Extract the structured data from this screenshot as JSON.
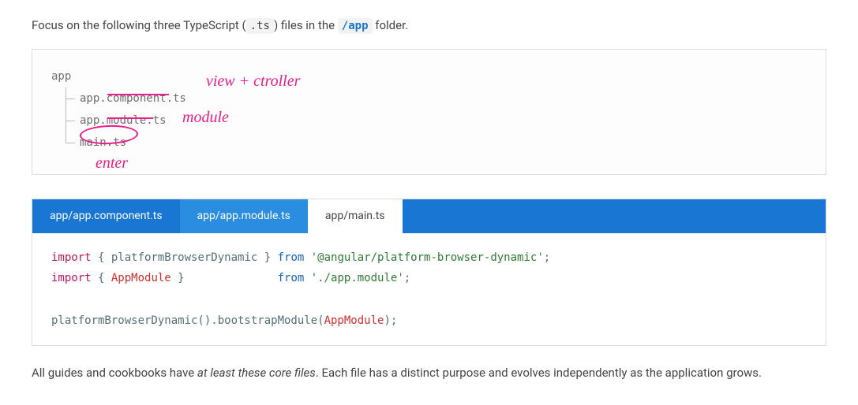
{
  "intro": {
    "prefix": "Focus on the following three TypeScript (",
    "ext": ".ts",
    "mid": ") files in the ",
    "folder": "/app",
    "suffix": " folder."
  },
  "tree": {
    "root": "app",
    "files": [
      "app.component.ts",
      "app.module.ts",
      "main.ts"
    ]
  },
  "annotations": {
    "a1": "view + ctroller",
    "a2": "module",
    "a3": "enter"
  },
  "tabs": {
    "t0": "app/app.component.ts",
    "t1": "app/app.module.ts",
    "t2": "app/main.ts"
  },
  "code": {
    "l1_import": "import",
    "l1_braces": " { platformBrowserDynamic } ",
    "l1_from": "from",
    "l1_str": " '@angular/platform-browser-dynamic'",
    "l1_semi": ";",
    "l2_import": "import",
    "l2_braces_open": " { ",
    "l2_typ": "AppModule",
    "l2_braces_close": " }              ",
    "l2_from": "from",
    "l2_str": " './app.module'",
    "l2_semi": ";",
    "l3_fn": "platformBrowserDynamic().bootstrapModule(",
    "l3_typ": "AppModule",
    "l3_close": ");"
  },
  "footer": {
    "p1": "All guides and cookbooks have ",
    "em": "at least these core files",
    "p2": ". Each file has a distinct purpose and evolves independently as the application grows."
  }
}
